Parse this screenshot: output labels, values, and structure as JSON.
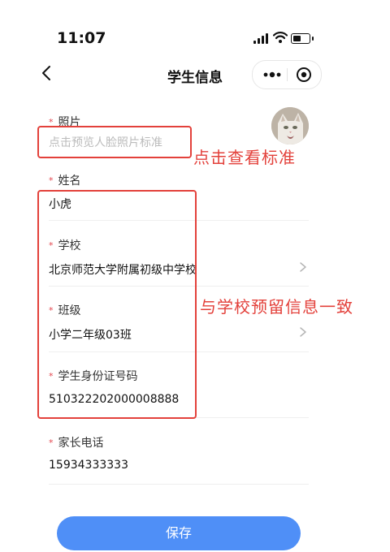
{
  "status_bar": {
    "time": "11:07"
  },
  "nav": {
    "title": "学生信息"
  },
  "fields": {
    "photo": {
      "label": "照片",
      "placeholder": "点击预览人脸照片标准"
    },
    "name": {
      "label": "姓名",
      "value": "小虎"
    },
    "school": {
      "label": "学校",
      "value": "北京师范大学附属初级中学校"
    },
    "class": {
      "label": "班级",
      "value": "小学二年级03班"
    },
    "id": {
      "label": "学生身份证号码",
      "value": "510322202000008888"
    },
    "phone": {
      "label": "家长电话",
      "value": "15934333333"
    }
  },
  "annotations": {
    "photo_note": "点击查看标准",
    "school_note": "与学校预留信息一致"
  },
  "save_label": "保存",
  "colors": {
    "accent": "#4f8ff7",
    "required_star": "#e3454d",
    "annotation": "#e3413b"
  }
}
